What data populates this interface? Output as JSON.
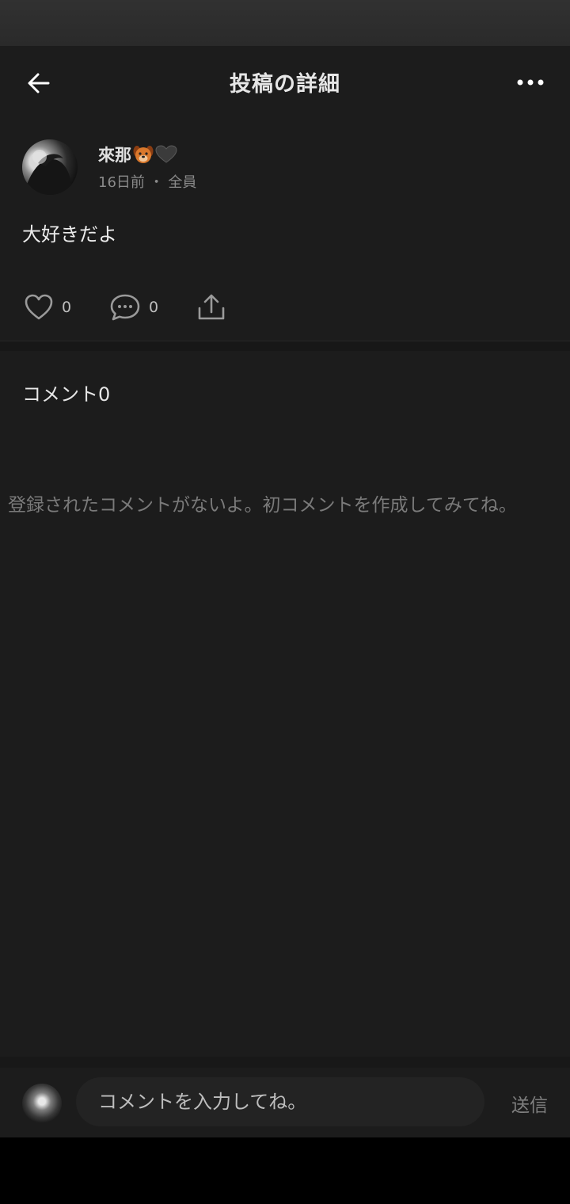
{
  "header": {
    "title": "投稿の詳細"
  },
  "post": {
    "author_name": "來那",
    "time": "16日前",
    "separator": "・",
    "audience": "全員",
    "body": "大好きだよ",
    "likes": "0",
    "comments": "0"
  },
  "comments_section": {
    "heading": "コメント0",
    "empty_message": "登録されたコメントがないよ。初コメントを作成してみてね。"
  },
  "composer": {
    "placeholder": "コメントを入力してね。",
    "send_label": "送信"
  },
  "icons": {
    "back": "arrow-left-icon",
    "more": "more-horizontal-icon",
    "like": "heart-outline-icon",
    "comment": "chat-bubble-icon",
    "share": "share-upload-icon",
    "name_emoji_1": "dog-face-emoji",
    "name_emoji_2": "black-heart-emoji"
  },
  "colors": {
    "background": "#1c1c1c",
    "status_bar": "#2f2f2f",
    "text_primary": "#e6e6e6",
    "text_secondary": "#8a8a8a",
    "input_bg": "#232323",
    "send_disabled": "#7f7f7f"
  }
}
